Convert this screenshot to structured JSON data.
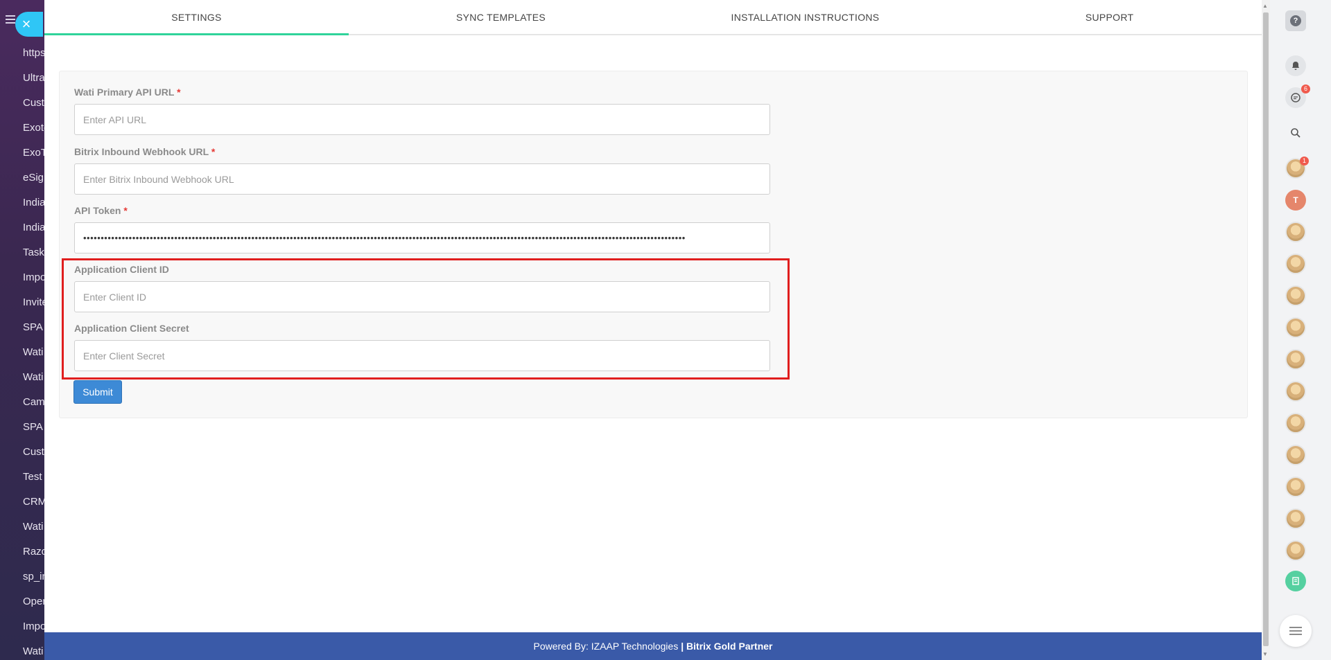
{
  "background_menu": {
    "items": [
      "https",
      "Ultra",
      "Custo",
      "Exote",
      "ExoT",
      "eSign",
      "India",
      "India",
      "Task",
      "Impo",
      "Invite",
      "SPA",
      "Wati",
      "Wati",
      "Cam",
      "SPA",
      "Custo",
      "Test",
      "CRM",
      "Wati",
      "Razo",
      "sp_in",
      "Oper",
      "Impo",
      "Wati"
    ]
  },
  "close_button": {
    "glyph": "×"
  },
  "tabs": [
    {
      "label": "SETTINGS",
      "active": true
    },
    {
      "label": "SYNC TEMPLATES",
      "active": false
    },
    {
      "label": "INSTALLATION INSTRUCTIONS",
      "active": false
    },
    {
      "label": "SUPPORT",
      "active": false
    }
  ],
  "form": {
    "api_url": {
      "label": "Wati Primary API URL",
      "required_mark": "*",
      "placeholder": "Enter API URL",
      "value": ""
    },
    "webhook_url": {
      "label": "Bitrix Inbound Webhook URL",
      "required_mark": "*",
      "placeholder": "Enter Bitrix Inbound Webhook URL",
      "value": ""
    },
    "api_token": {
      "label": "API Token",
      "required_mark": "*",
      "masked_value": "••••••••••••••••••••••••••••••••••••••••••••••••••••••••••••••••••••••••••••••••••••••••••••••••••••••••••••••••••••••••••••••••••••••••••••••••••••••••••••••••••••••••••••"
    },
    "client_id": {
      "label": "Application Client ID",
      "placeholder": "Enter Client ID",
      "value": ""
    },
    "client_secret": {
      "label": "Application Client Secret",
      "placeholder": "Enter Client Secret",
      "value": ""
    },
    "submit_label": "Submit"
  },
  "footer": {
    "prefix": "Powered By: IZAAP Technologies",
    "separator": "|",
    "partner": "Bitrix Gold Partner"
  },
  "right_rail": {
    "chat_badge": "6",
    "avatar_badge": "1",
    "avatar_initial": "T"
  },
  "colors": {
    "active_tab_underline": "#2fd39a",
    "submit_button": "#3d8ad6",
    "footer": "#3a5aa8",
    "highlight_box": "#e01e1e",
    "required_asterisk": "#e53935"
  }
}
